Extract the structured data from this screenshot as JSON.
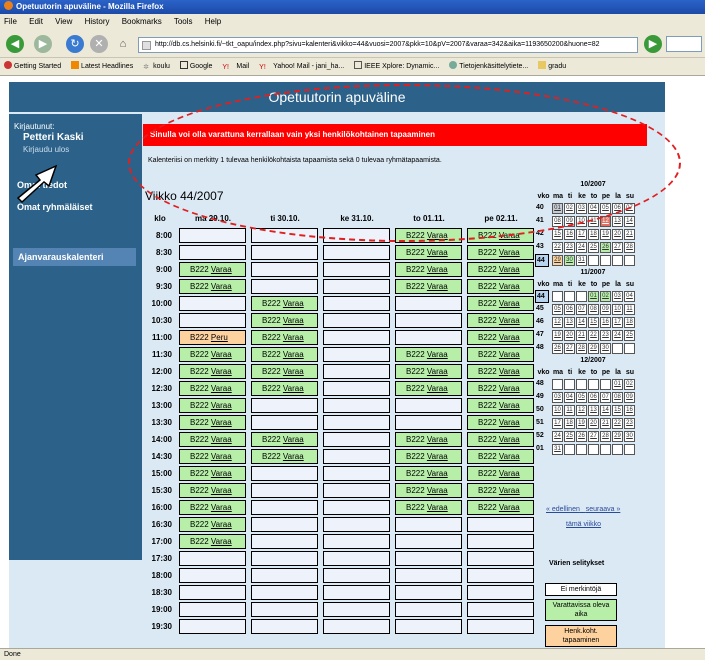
{
  "window": {
    "title": "Opetuutorin apuväline - Mozilla Firefox"
  },
  "menu": [
    "File",
    "Edit",
    "View",
    "History",
    "Bookmarks",
    "Tools",
    "Help"
  ],
  "url": "http://db.cs.helsinki.fi/~tkt_oapu/index.php?sivu=kalenteri&vikko=44&vuosi=2007&pkk=10&pV=2007&varaa=342&aika=1193650200&huone=82",
  "bookmarks": [
    "Getting Started",
    "Latest Headlines",
    "koulu",
    "Google",
    "Mail",
    "Yahoo! Mail - jani_ha...",
    "IEEE Xplore: Dynamic...",
    "Tietojenkäsittelytiete...",
    "gradu"
  ],
  "status": "Done",
  "header": {
    "title": "Opetuutorin apuväline"
  },
  "sidebar": {
    "logged_label": "Kirjautunut:",
    "user": "Petteri Kaski",
    "logout": "Kirjaudu ulos",
    "items": [
      "Omat tiedot",
      "Omat ryhmäläiset",
      "Ajanvarauskalenteri"
    ]
  },
  "alert": "Sinulla voi olla varattuna kerrallaan vain yksi henkilökohtainen tapaaminen",
  "info": "Kalenteriisi on merkitty 1 tulevaa henkilökohtaista tapaamista sekä 0 tulevaa ryhmätapaamista.",
  "week_title": "Viikko 44/2007",
  "schedule": {
    "klo_header": "klo",
    "days": [
      "ma 29.10.",
      "ti 30.10.",
      "ke 31.10.",
      "to 01.11.",
      "pe 02.11."
    ],
    "room": "B222",
    "book": "Varaa",
    "cancel": "Peru",
    "rows": [
      {
        "time": "8:00",
        "s": [
          "",
          "",
          "",
          "F",
          "F"
        ]
      },
      {
        "time": "8:30",
        "s": [
          "",
          "",
          "",
          "F",
          "F"
        ]
      },
      {
        "time": "9:00",
        "s": [
          "F",
          "",
          "",
          "F",
          "F"
        ]
      },
      {
        "time": "9:30",
        "s": [
          "F",
          "",
          "",
          "F",
          "F"
        ]
      },
      {
        "time": "10:00",
        "s": [
          "",
          "F",
          "",
          "",
          "F"
        ]
      },
      {
        "time": "10:30",
        "s": [
          "",
          "F",
          "",
          "",
          "F"
        ]
      },
      {
        "time": "11:00",
        "s": [
          "O",
          "F",
          "",
          "",
          "F"
        ]
      },
      {
        "time": "11:30",
        "s": [
          "F",
          "F",
          "",
          "F",
          "F"
        ]
      },
      {
        "time": "12:00",
        "s": [
          "F",
          "F",
          "",
          "F",
          "F"
        ]
      },
      {
        "time": "12:30",
        "s": [
          "F",
          "F",
          "",
          "F",
          "F"
        ]
      },
      {
        "time": "13:00",
        "s": [
          "F",
          "",
          "",
          "",
          "F"
        ]
      },
      {
        "time": "13:30",
        "s": [
          "F",
          "",
          "",
          "",
          "F"
        ]
      },
      {
        "time": "14:00",
        "s": [
          "F",
          "F",
          "",
          "F",
          "F"
        ]
      },
      {
        "time": "14:30",
        "s": [
          "F",
          "F",
          "",
          "F",
          "F"
        ]
      },
      {
        "time": "15:00",
        "s": [
          "F",
          "",
          "",
          "F",
          "F"
        ]
      },
      {
        "time": "15:30",
        "s": [
          "F",
          "",
          "",
          "F",
          "F"
        ]
      },
      {
        "time": "16:00",
        "s": [
          "F",
          "",
          "",
          "F",
          "F"
        ]
      },
      {
        "time": "16:30",
        "s": [
          "F",
          "",
          "",
          "",
          ""
        ]
      },
      {
        "time": "17:00",
        "s": [
          "F",
          "",
          "",
          "",
          ""
        ]
      },
      {
        "time": "17:30",
        "s": [
          "",
          "",
          "",
          "",
          ""
        ]
      },
      {
        "time": "18:00",
        "s": [
          "",
          "",
          "",
          "",
          ""
        ]
      },
      {
        "time": "18:30",
        "s": [
          "",
          "",
          "",
          "",
          ""
        ]
      },
      {
        "time": "19:00",
        "s": [
          "",
          "",
          "",
          "",
          ""
        ]
      },
      {
        "time": "19:30",
        "s": [
          "",
          "",
          "",
          "",
          ""
        ]
      }
    ]
  },
  "calendar": {
    "dow": [
      "vko",
      "ma",
      "ti",
      "ke",
      "to",
      "pe",
      "la",
      "su"
    ],
    "months": [
      {
        "title": "10/2007",
        "weeks": [
          {
            "n": "40",
            "d": [
              "01",
              "02",
              "03",
              "04",
              "05",
              "06",
              "07"
            ],
            "st": [
              "p",
              "",
              "",
              "",
              "",
              "",
              ""
            ]
          },
          {
            "n": "41",
            "d": [
              "08",
              "09",
              "10",
              "11",
              "12",
              "13",
              "14"
            ],
            "st": [
              "",
              "",
              "",
              "",
              "t",
              "",
              ""
            ]
          },
          {
            "n": "42",
            "d": [
              "15",
              "16",
              "17",
              "18",
              "19",
              "20",
              "21"
            ],
            "st": [
              "",
              "",
              "",
              "",
              "",
              "",
              ""
            ]
          },
          {
            "n": "43",
            "d": [
              "22",
              "23",
              "24",
              "25",
              "26",
              "27",
              "28"
            ],
            "st": [
              "",
              "",
              "",
              "",
              "g",
              "",
              ""
            ]
          },
          {
            "n": "44",
            "d": [
              "29",
              "30",
              "31",
              "",
              "",
              "",
              ""
            ],
            "st": [
              "o",
              "g",
              "",
              "e",
              "e",
              "e",
              "e"
            ],
            "hi": true
          }
        ]
      },
      {
        "title": "11/2007",
        "weeks": [
          {
            "n": "44",
            "d": [
              "",
              "",
              "",
              "01",
              "02",
              "03",
              "04"
            ],
            "st": [
              "e",
              "e",
              "e",
              "g",
              "g",
              "",
              ""
            ],
            "hi": true
          },
          {
            "n": "45",
            "d": [
              "05",
              "06",
              "07",
              "08",
              "09",
              "10",
              "11"
            ],
            "st": [
              "",
              "",
              "",
              "",
              "",
              "",
              ""
            ]
          },
          {
            "n": "46",
            "d": [
              "12",
              "13",
              "14",
              "15",
              "16",
              "17",
              "18"
            ],
            "st": [
              "",
              "",
              "",
              "",
              "",
              "",
              ""
            ]
          },
          {
            "n": "47",
            "d": [
              "19",
              "20",
              "21",
              "22",
              "23",
              "24",
              "25"
            ],
            "st": [
              "",
              "",
              "",
              "",
              "",
              "",
              ""
            ]
          },
          {
            "n": "48",
            "d": [
              "26",
              "27",
              "28",
              "29",
              "30",
              "",
              ""
            ],
            "st": [
              "",
              "",
              "",
              "",
              "",
              "e",
              "e"
            ]
          }
        ]
      },
      {
        "title": "12/2007",
        "weeks": [
          {
            "n": "48",
            "d": [
              "",
              "",
              "",
              "",
              "",
              "01",
              "02"
            ],
            "st": [
              "e",
              "e",
              "e",
              "e",
              "e",
              "",
              ""
            ]
          },
          {
            "n": "49",
            "d": [
              "03",
              "04",
              "05",
              "06",
              "07",
              "08",
              "09"
            ],
            "st": [
              "",
              "",
              "",
              "",
              "",
              "",
              ""
            ]
          },
          {
            "n": "50",
            "d": [
              "10",
              "11",
              "12",
              "13",
              "14",
              "15",
              "16"
            ],
            "st": [
              "",
              "",
              "",
              "",
              "",
              "",
              ""
            ]
          },
          {
            "n": "51",
            "d": [
              "17",
              "18",
              "19",
              "20",
              "21",
              "22",
              "23"
            ],
            "st": [
              "",
              "",
              "",
              "",
              "",
              "",
              ""
            ]
          },
          {
            "n": "52",
            "d": [
              "24",
              "25",
              "26",
              "27",
              "28",
              "29",
              "30"
            ],
            "st": [
              "",
              "",
              "",
              "",
              "",
              "",
              ""
            ]
          },
          {
            "n": "01",
            "d": [
              "31",
              "",
              "",
              "",
              "",
              "",
              ""
            ],
            "st": [
              "",
              "e",
              "e",
              "e",
              "e",
              "e",
              "e"
            ]
          }
        ]
      }
    ],
    "prev": "« edellinen",
    "next": "seuraava »",
    "this_week": "tämä viikko"
  },
  "legend": {
    "title": "Värien selitykset",
    "items": [
      "Ei merkintöjä",
      "Varattavissa oleva aika",
      "Henk.koht. tapaaminen"
    ]
  },
  "colors": {
    "header": "#2c6289",
    "page": "#dbe9f5",
    "alert": "#ff0000",
    "free": "#b7efa9",
    "own": "#fdd29f",
    "annotation": "#e02020"
  }
}
